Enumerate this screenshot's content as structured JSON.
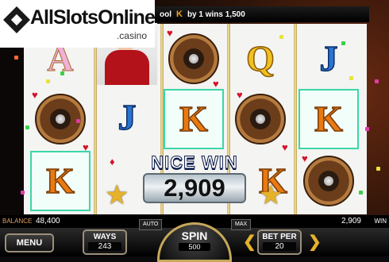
{
  "logo": {
    "brand": "AllSlotsOnline",
    "sub": ".casino"
  },
  "topbar": {
    "text_left": "ool",
    "symbol": "K",
    "text_right": "by 1 wins 1,500"
  },
  "reels": [
    [
      "A",
      "roulette",
      "K"
    ],
    [
      "lady",
      "J",
      "card"
    ],
    [
      "roulette",
      "K",
      "card"
    ],
    [
      "Q",
      "roulette",
      "K"
    ],
    [
      "J",
      "K",
      "roulette"
    ]
  ],
  "win": {
    "title": "NICE WIN",
    "amount": "2,909"
  },
  "balance": {
    "label": "BALANCE",
    "value": "48,400"
  },
  "win_total": {
    "value": "2,909",
    "label": "WIN"
  },
  "buttons": {
    "menu": "MENU",
    "auto": "AUTO",
    "max": "MAX",
    "ways_label": "WAYS",
    "ways_value": "243",
    "spin_label": "SPIN",
    "spin_value": "500",
    "betper_label": "BET PER",
    "betper_value": "20"
  },
  "icons": {
    "left_arrow": "chevron-left-icon",
    "right_arrow": "chevron-right-icon"
  },
  "colors": {
    "accent_gold": "#e5b22a",
    "highlight": "#3bd6a8",
    "suit_red": "#d4142a"
  }
}
